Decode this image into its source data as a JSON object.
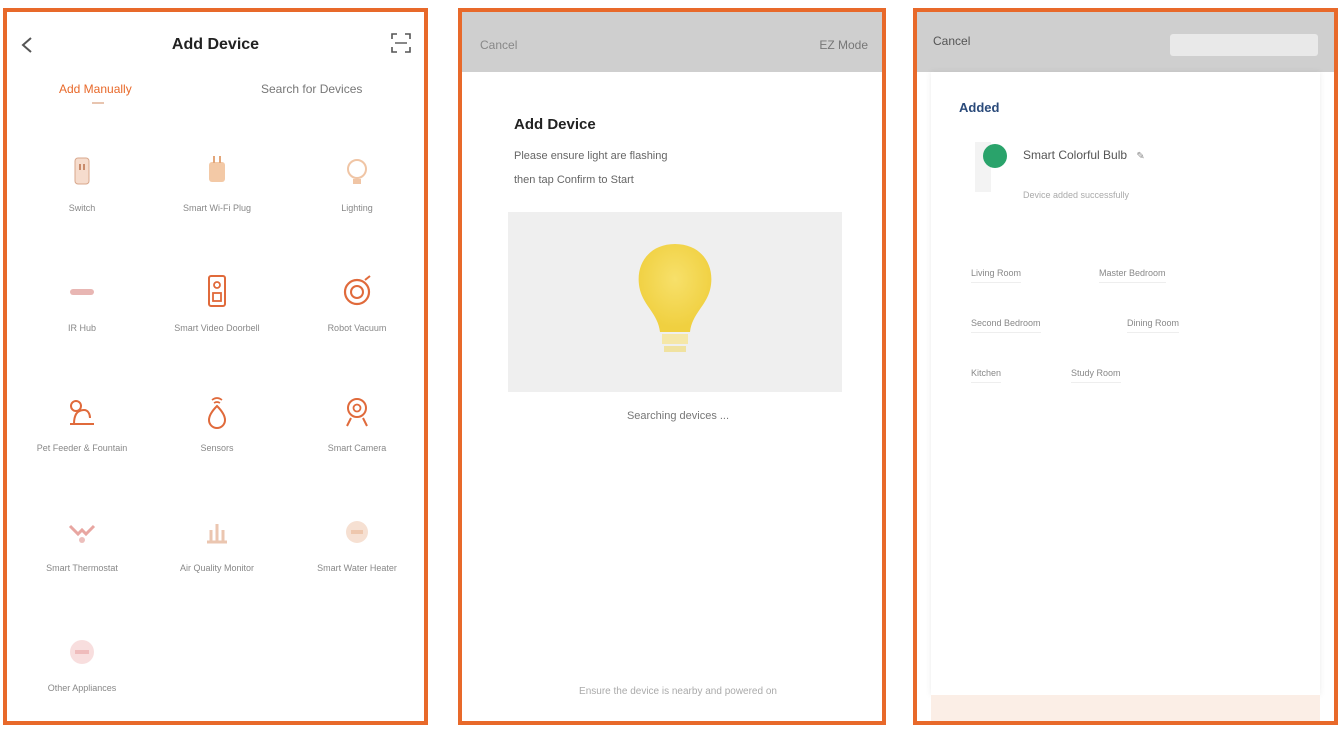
{
  "panel1": {
    "title": "Add Device",
    "tabs": [
      "Add Manually",
      "Search for Devices"
    ],
    "devices": [
      {
        "label": "Switch",
        "icon": "socket-icon"
      },
      {
        "label": "Smart Wi-Fi Plug",
        "icon": "plug-icon"
      },
      {
        "label": "Lighting",
        "icon": "bulb-icon"
      },
      {
        "label": "IR Hub",
        "icon": "remote-icon"
      },
      {
        "label": "Smart Video Doorbell",
        "icon": "doorbell-icon"
      },
      {
        "label": "Robot Vacuum",
        "icon": "vacuum-icon"
      },
      {
        "label": "Pet Feeder & Fountain",
        "icon": "pet-icon"
      },
      {
        "label": "Sensors",
        "icon": "sensor-icon"
      },
      {
        "label": "Smart Camera",
        "icon": "camera-icon"
      },
      {
        "label": "Smart Thermostat",
        "icon": "thermostat-icon"
      },
      {
        "label": "Air Quality Monitor",
        "icon": "air-icon"
      },
      {
        "label": "Smart Water Heater",
        "icon": "heater-icon"
      },
      {
        "label": "Other Appliances",
        "icon": "appliance-icon"
      }
    ]
  },
  "panel2": {
    "cancel": "Cancel",
    "right": "EZ Mode",
    "heading": "Add Device",
    "desc1": "Please ensure light are flashing",
    "desc2": "then tap Confirm to Start",
    "searching": "Searching devices ...",
    "bottom": "Ensure the device is nearby and powered on"
  },
  "panel3": {
    "cancel": "Cancel",
    "heading": "Added",
    "device": "Smart Colorful Bulb",
    "device_sub": "Device added successfully",
    "tags": [
      "Living Room",
      "Master Bedroom",
      "Second Bedroom",
      "Dining Room",
      "Kitchen",
      "Study Room"
    ]
  }
}
